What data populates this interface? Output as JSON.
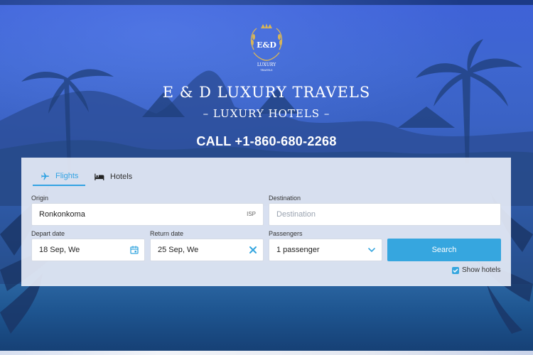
{
  "header": {
    "logo_text": "E&D",
    "logo_sub": "LUXURY",
    "logo_sub2": "TRAVELS",
    "title": "E & D LUXURY TRAVELS",
    "subtitle": "– LUXURY HOTELS –",
    "phone": "CALL +1-860-680-2268"
  },
  "tabs": [
    {
      "label": "Flights",
      "icon": "plane-icon",
      "active": true
    },
    {
      "label": "Hotels",
      "icon": "bed-icon",
      "active": false
    }
  ],
  "form": {
    "origin": {
      "label": "Origin",
      "value": "Ronkonkoma",
      "tag": "ISP"
    },
    "destination": {
      "label": "Destination",
      "placeholder": "Destination"
    },
    "depart": {
      "label": "Depart date",
      "value": "18 Sep, We",
      "icon": "calendar-icon"
    },
    "return": {
      "label": "Return date",
      "value": "25 Sep, We",
      "icon": "clear-icon"
    },
    "passengers": {
      "label": "Passengers",
      "value": "1 passenger",
      "icon": "chevron-down-icon"
    },
    "search_label": "Search",
    "show_hotels": {
      "label": "Show hotels",
      "checked": true
    }
  },
  "colors": {
    "accent": "#36a6df",
    "panel": "#ebf0fa",
    "background": "#3a62c4"
  }
}
